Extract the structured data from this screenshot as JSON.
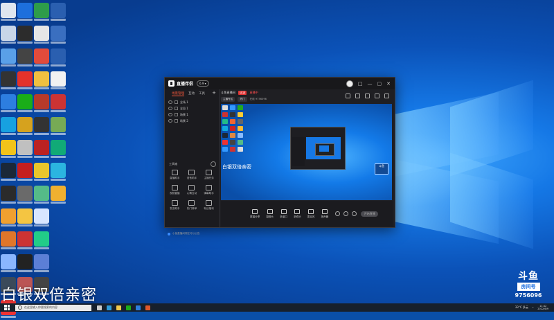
{
  "app": {
    "brand": "直播伴侣",
    "version_badge": "6.9 ▾",
    "window_controls": [
      "☺",
      "□",
      "—",
      "▢",
      "✕"
    ]
  },
  "sidebar": {
    "tabs": [
      "场景管理",
      "互动",
      "工具"
    ],
    "add": "+",
    "scenes": [
      "全场 1",
      "全局 1",
      "场景 1",
      "场景 2"
    ],
    "tools_title": "工具箱",
    "tools": [
      "直播助手",
      "语音助手",
      "主播任务",
      "视频直播",
      "心情互动",
      "弹幕助手",
      "发言助手",
      "热门榜单",
      "粉丝福利"
    ],
    "notice": "小鱼直播间现在可以公告"
  },
  "room": {
    "title": "斗鱼直播间",
    "badge_1": "认证",
    "badge_2": "直播中",
    "chip_1": "主播专区",
    "chip_2": "热门",
    "meta": "在线 9756096",
    "icons": [
      "share-icon",
      "settings-icon",
      "record-icon",
      "expand-icon",
      "more-icon"
    ]
  },
  "preview": {
    "caption": "白银双倍亲密",
    "badge": "斗鱼"
  },
  "controls": {
    "items": [
      "屏幕分享",
      "摄像头",
      "多窗口",
      "多镜头",
      "麦克风",
      "扬声器"
    ],
    "start_label": "开始直播"
  },
  "overlay": {
    "caption": "白银双倍亲密",
    "brand_top": "斗鱼",
    "brand_mid": "房间号",
    "brand_num": "9756096"
  },
  "taskbar": {
    "search_placeholder": "在这里输入你要搜索的内容",
    "weather": "33°C 多云",
    "time": "11:42",
    "date": "2022/6/9"
  },
  "colors": {
    "accent": "#ff5b3d",
    "wallpaper_blue": "#1578e6",
    "window_bg": "#1f1f23"
  }
}
